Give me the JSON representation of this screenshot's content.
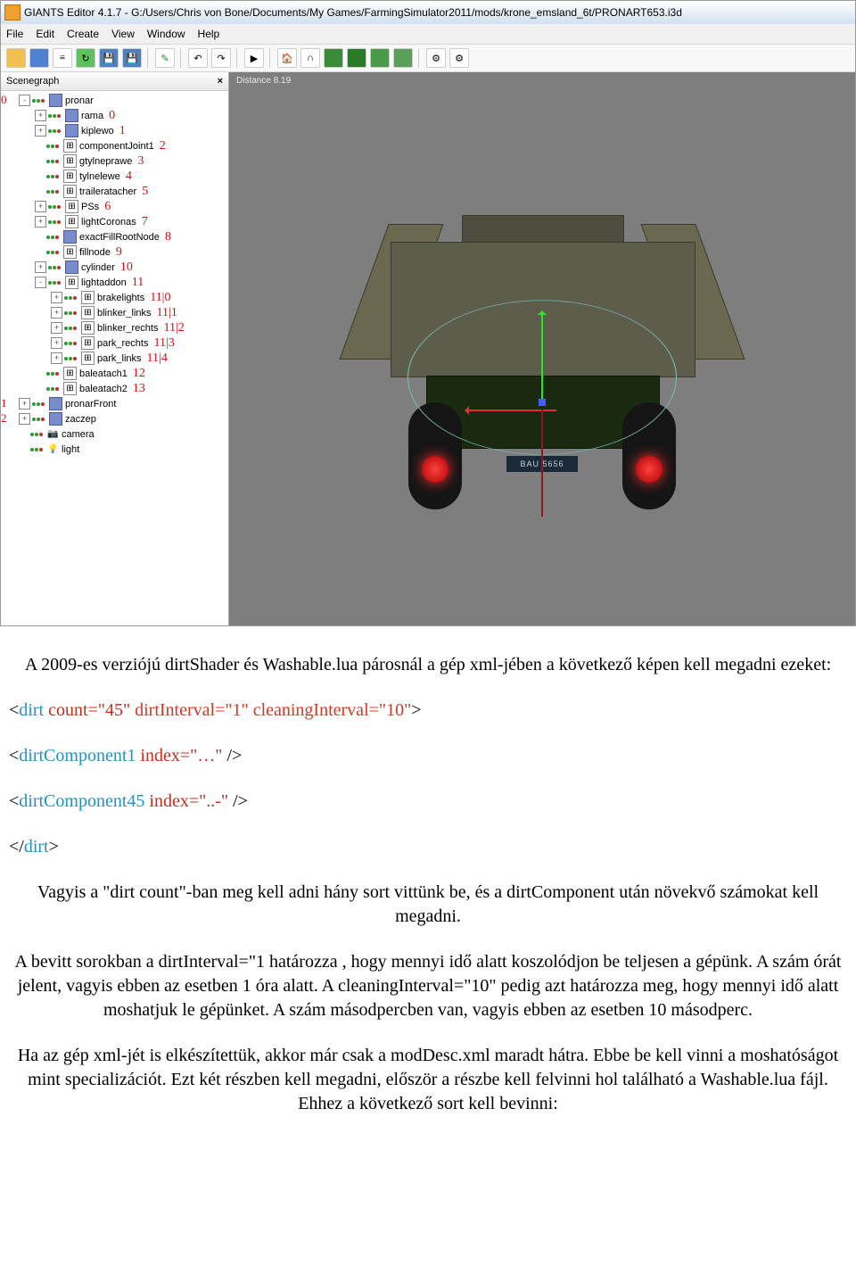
{
  "titlebar": {
    "app": "GIANTS Editor 4.1.7",
    "path": "G:/Users/Chris von Bone/Documents/My Games/FarmingSimulator2011/mods/krone_emsland_6t/PRONART653.i3d"
  },
  "menubar": [
    "File",
    "Edit",
    "Create",
    "View",
    "Window",
    "Help"
  ],
  "panel": {
    "title": "Scenegraph",
    "close": "×"
  },
  "viewport": {
    "distance": "Distance 8.19",
    "plate": "BAU 5656"
  },
  "root_annos": [
    "0",
    "1",
    "2"
  ],
  "tree": [
    {
      "depth": 0,
      "exp": "-",
      "icon": "cube",
      "label": "pronar",
      "anno": ""
    },
    {
      "depth": 1,
      "exp": "+",
      "icon": "cube",
      "label": "rama",
      "anno": "0"
    },
    {
      "depth": 1,
      "exp": "+",
      "icon": "cube",
      "label": "kiplewo",
      "anno": "1"
    },
    {
      "depth": 1,
      "exp": " ",
      "icon": "group",
      "label": "componentJoint1",
      "anno": "2"
    },
    {
      "depth": 1,
      "exp": " ",
      "icon": "group",
      "label": "gtylneprawe",
      "anno": "3"
    },
    {
      "depth": 1,
      "exp": " ",
      "icon": "group",
      "label": "tylnelewe",
      "anno": "4"
    },
    {
      "depth": 1,
      "exp": " ",
      "icon": "group",
      "label": "traileratacher",
      "anno": "5"
    },
    {
      "depth": 1,
      "exp": "+",
      "icon": "group",
      "label": "PSs",
      "anno": "6"
    },
    {
      "depth": 1,
      "exp": "+",
      "icon": "group",
      "label": "lightCoronas",
      "anno": "7"
    },
    {
      "depth": 1,
      "exp": " ",
      "icon": "cube",
      "label": "exactFillRootNode",
      "anno": "8"
    },
    {
      "depth": 1,
      "exp": " ",
      "icon": "group",
      "label": "fillnode",
      "anno": "9"
    },
    {
      "depth": 1,
      "exp": "+",
      "icon": "cube",
      "label": "cylinder",
      "anno": "10"
    },
    {
      "depth": 1,
      "exp": "-",
      "icon": "group",
      "label": "lightaddon",
      "anno": "11"
    },
    {
      "depth": 2,
      "exp": "+",
      "icon": "group",
      "label": "brakelights",
      "anno": "11|0"
    },
    {
      "depth": 2,
      "exp": "+",
      "icon": "group",
      "label": "blinker_links",
      "anno": "11|1"
    },
    {
      "depth": 2,
      "exp": "+",
      "icon": "group",
      "label": "blinker_rechts",
      "anno": "11|2"
    },
    {
      "depth": 2,
      "exp": "+",
      "icon": "group",
      "label": "park_rechts",
      "anno": "11|3"
    },
    {
      "depth": 2,
      "exp": "+",
      "icon": "group",
      "label": "park_links",
      "anno": "11|4"
    },
    {
      "depth": 1,
      "exp": " ",
      "icon": "group",
      "label": "baleatach1",
      "anno": "12"
    },
    {
      "depth": 1,
      "exp": " ",
      "icon": "group",
      "label": "baleatach2",
      "anno": "13"
    },
    {
      "depth": 0,
      "exp": "+",
      "icon": "cube",
      "label": "pronarFront",
      "anno": ""
    },
    {
      "depth": 0,
      "exp": "+",
      "icon": "cube",
      "label": "zaczep",
      "anno": ""
    },
    {
      "depth": 0,
      "exp": " ",
      "icon": "cam",
      "label": "camera",
      "anno": ""
    },
    {
      "depth": 0,
      "exp": " ",
      "icon": "light",
      "label": "light",
      "anno": ""
    }
  ],
  "article": {
    "p1": "A 2009-es verziójú dirtShader és Washable.lua párosnál a gép xml-jében a következő képen kell megadni ezeket:",
    "xml": {
      "l1": {
        "open": "<",
        "tag": "dirt",
        "a1": " count=\"45\"",
        "a2": " dirtInterval=\"1\"",
        "a3": " cleaningInterval=\"10\"",
        "close": ">"
      },
      "l2": {
        "open": "<",
        "tag": "dirtComponent1",
        "a1": " index=\"…\"",
        "close": " />"
      },
      "l3": {
        "open": "<",
        "tag": "dirtComponent45",
        "a1": " index=\"..-\"",
        "close": " />"
      },
      "l4": {
        "open": "</",
        "tag": "dirt",
        "close": ">"
      }
    },
    "p2": "Vagyis a \"dirt count\"-ban meg kell adni hány sort vittünk be, és a dirtComponent után növekvő számokat kell megadni.",
    "p3": "A bevitt sorokban a dirtInterval=\"1 határozza , hogy mennyi idő alatt koszolódjon be teljesen a gépünk. A szám órát jelent, vagyis ebben az esetben 1 óra alatt. A cleaningInterval=\"10\" pedig azt határozza meg, hogy mennyi idő alatt moshatjuk le gépünket. A szám másodpercben van, vagyis ebben az esetben 10 másodperc.",
    "p4": "Ha az gép xml-jét is elkészítettük, akkor már csak a modDesc.xml maradt hátra. Ebbe be kell vinni a moshatóságot mint specializációt. Ezt két részben kell megadni, először a részbe kell felvinni hol található a Washable.lua fájl. Ehhez a következő sort kell bevinni:"
  }
}
